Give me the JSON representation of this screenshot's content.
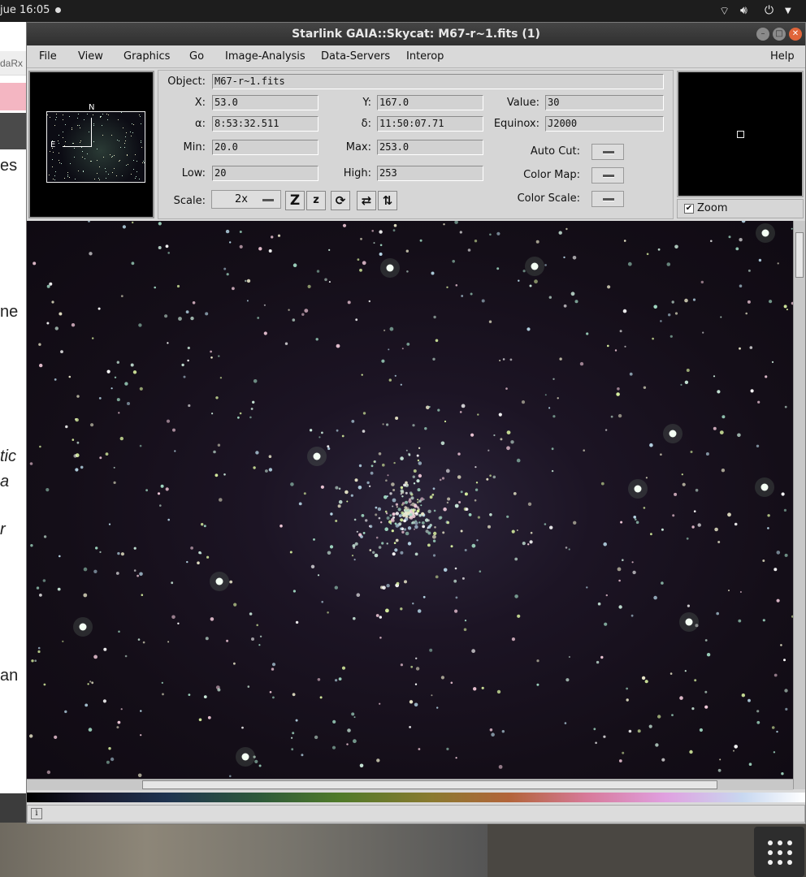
{
  "topbar": {
    "clock": "jue 16:05",
    "tray_icons": [
      "wifi-icon",
      "volume-icon",
      "power-icon",
      "chevron-down-icon"
    ]
  },
  "background_window": {
    "tab_fragment": "daRx",
    "text_fragments": [
      "es",
      "ne",
      "tic",
      "a",
      "r",
      "an"
    ]
  },
  "window": {
    "title": "Starlink GAIA::Skycat: M67-r~1.fits (1)",
    "menus": [
      "File",
      "View",
      "Graphics",
      "Go",
      "Image-Analysis",
      "Data-Servers",
      "Interop"
    ],
    "help_menu": "Help"
  },
  "compass": {
    "north": "N",
    "east": "E"
  },
  "info": {
    "object_label": "Object:",
    "object_value": "M67-r~1.fits",
    "x_label": "X:",
    "x_value": "53.0",
    "y_label": "Y:",
    "y_value": "167.0",
    "value_label": "Value:",
    "value_value": "30",
    "ra_label": "α:",
    "ra_value": "8:53:32.511",
    "dec_label": "δ:",
    "dec_value": "11:50:07.71",
    "equinox_label": "Equinox:",
    "equinox_value": "J2000",
    "min_label": "Min:",
    "min_value": "20.0",
    "max_label": "Max:",
    "max_value": "253.0",
    "low_label": "Low:",
    "low_value": "20",
    "high_label": "High:",
    "high_value": "253",
    "autocut_label": "Auto Cut:",
    "colormap_label": "Color Map:",
    "colorscale_label": "Color Scale:",
    "scale_label": "Scale:",
    "scale_value": "2x",
    "tool_buttons": [
      "Z",
      "z"
    ]
  },
  "zoom": {
    "label": "Zoom",
    "checked": "✔"
  },
  "status": {
    "info_icon": "i"
  },
  "colors": {
    "titlebar": "#3a3a3a",
    "close_button": "#e0653a",
    "image_bg": "#140e18"
  }
}
